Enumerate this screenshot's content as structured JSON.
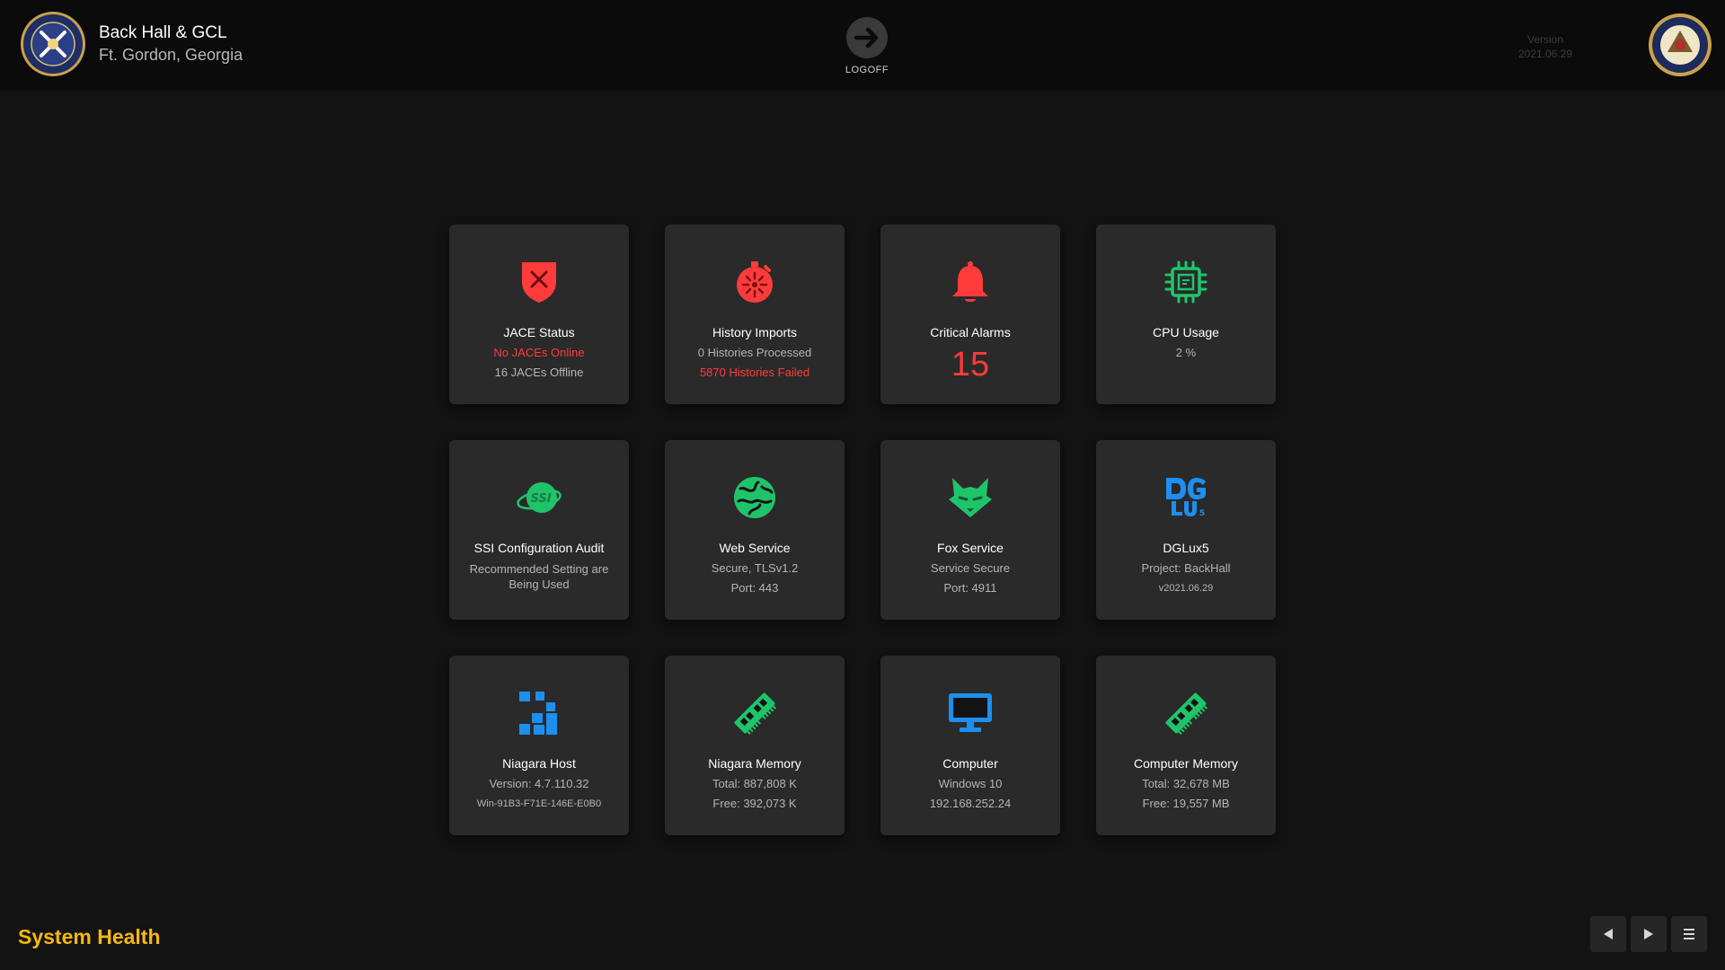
{
  "header": {
    "title": "Back Hall & GCL",
    "subtitle": "Ft. Gordon, Georgia",
    "logoff_label": "LOGOFF",
    "version_label": "Version",
    "version_value": "2021.06.29"
  },
  "cards": {
    "jace": {
      "title": "JACE Status",
      "line1": "No JACEs Online",
      "line2": "16 JACEs Offline",
      "icon": "shield-x-icon"
    },
    "history": {
      "title": "History Imports",
      "line1": "0 Histories Processed",
      "line2": "5870 Histories Failed",
      "icon": "stopwatch-icon"
    },
    "alarms": {
      "title": "Critical Alarms",
      "value": "15",
      "icon": "bell-icon"
    },
    "cpu": {
      "title": "CPU Usage",
      "line1": "2 %",
      "icon": "cpu-chip-icon"
    },
    "ssi": {
      "title": "SSI Configuration Audit",
      "line1": "Recommended Setting are Being Used",
      "icon": "ssi-logo-icon"
    },
    "web": {
      "title": "Web Service",
      "line1": "Secure, TLSv1.2",
      "line2": "Port: 443",
      "icon": "globe-icon"
    },
    "fox": {
      "title": "Fox Service",
      "line1": "Service Secure",
      "line2": "Port: 4911",
      "icon": "fox-icon"
    },
    "dglux": {
      "title": "DGLux5",
      "line1": "Project: BackHall",
      "line2": "v2021.06.29",
      "icon": "dglux-logo-icon"
    },
    "niagara_host": {
      "title": "Niagara Host",
      "line1": "Version: 4.7.110.32",
      "line2": "Win-91B3-F71E-146E-E0B0",
      "icon": "niagara-host-icon"
    },
    "niagara_mem": {
      "title": "Niagara Memory",
      "line1": "Total: 887,808 K",
      "line2": "Free: 392,073 K",
      "icon": "memory-stick-icon"
    },
    "computer": {
      "title": "Computer",
      "line1": "Windows 10",
      "line2": "192.168.252.24",
      "icon": "monitor-icon"
    },
    "computer_mem": {
      "title": "Computer Memory",
      "line1": "Total: 32,678 MB",
      "line2": "Free: 19,557 MB",
      "icon": "memory-stick-icon"
    }
  },
  "footer": {
    "page_title": "System Health"
  },
  "colors": {
    "accent_yellow": "#f5b80f",
    "alert_red": "#ff3b3b",
    "ok_green": "#1fc46a",
    "info_blue": "#1c8ff0"
  }
}
